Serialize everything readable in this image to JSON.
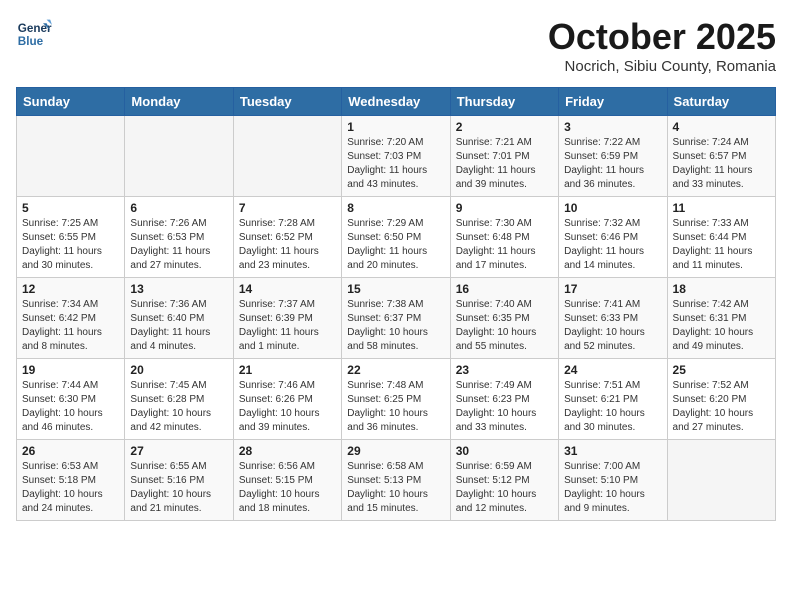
{
  "logo": {
    "line1": "General",
    "line2": "Blue"
  },
  "title": "October 2025",
  "subtitle": "Nocrich, Sibiu County, Romania",
  "days_of_week": [
    "Sunday",
    "Monday",
    "Tuesday",
    "Wednesday",
    "Thursday",
    "Friday",
    "Saturday"
  ],
  "weeks": [
    [
      {
        "day": "",
        "content": ""
      },
      {
        "day": "",
        "content": ""
      },
      {
        "day": "",
        "content": ""
      },
      {
        "day": "1",
        "content": "Sunrise: 7:20 AM\nSunset: 7:03 PM\nDaylight: 11 hours and 43 minutes."
      },
      {
        "day": "2",
        "content": "Sunrise: 7:21 AM\nSunset: 7:01 PM\nDaylight: 11 hours and 39 minutes."
      },
      {
        "day": "3",
        "content": "Sunrise: 7:22 AM\nSunset: 6:59 PM\nDaylight: 11 hours and 36 minutes."
      },
      {
        "day": "4",
        "content": "Sunrise: 7:24 AM\nSunset: 6:57 PM\nDaylight: 11 hours and 33 minutes."
      }
    ],
    [
      {
        "day": "5",
        "content": "Sunrise: 7:25 AM\nSunset: 6:55 PM\nDaylight: 11 hours and 30 minutes."
      },
      {
        "day": "6",
        "content": "Sunrise: 7:26 AM\nSunset: 6:53 PM\nDaylight: 11 hours and 27 minutes."
      },
      {
        "day": "7",
        "content": "Sunrise: 7:28 AM\nSunset: 6:52 PM\nDaylight: 11 hours and 23 minutes."
      },
      {
        "day": "8",
        "content": "Sunrise: 7:29 AM\nSunset: 6:50 PM\nDaylight: 11 hours and 20 minutes."
      },
      {
        "day": "9",
        "content": "Sunrise: 7:30 AM\nSunset: 6:48 PM\nDaylight: 11 hours and 17 minutes."
      },
      {
        "day": "10",
        "content": "Sunrise: 7:32 AM\nSunset: 6:46 PM\nDaylight: 11 hours and 14 minutes."
      },
      {
        "day": "11",
        "content": "Sunrise: 7:33 AM\nSunset: 6:44 PM\nDaylight: 11 hours and 11 minutes."
      }
    ],
    [
      {
        "day": "12",
        "content": "Sunrise: 7:34 AM\nSunset: 6:42 PM\nDaylight: 11 hours and 8 minutes."
      },
      {
        "day": "13",
        "content": "Sunrise: 7:36 AM\nSunset: 6:40 PM\nDaylight: 11 hours and 4 minutes."
      },
      {
        "day": "14",
        "content": "Sunrise: 7:37 AM\nSunset: 6:39 PM\nDaylight: 11 hours and 1 minute."
      },
      {
        "day": "15",
        "content": "Sunrise: 7:38 AM\nSunset: 6:37 PM\nDaylight: 10 hours and 58 minutes."
      },
      {
        "day": "16",
        "content": "Sunrise: 7:40 AM\nSunset: 6:35 PM\nDaylight: 10 hours and 55 minutes."
      },
      {
        "day": "17",
        "content": "Sunrise: 7:41 AM\nSunset: 6:33 PM\nDaylight: 10 hours and 52 minutes."
      },
      {
        "day": "18",
        "content": "Sunrise: 7:42 AM\nSunset: 6:31 PM\nDaylight: 10 hours and 49 minutes."
      }
    ],
    [
      {
        "day": "19",
        "content": "Sunrise: 7:44 AM\nSunset: 6:30 PM\nDaylight: 10 hours and 46 minutes."
      },
      {
        "day": "20",
        "content": "Sunrise: 7:45 AM\nSunset: 6:28 PM\nDaylight: 10 hours and 42 minutes."
      },
      {
        "day": "21",
        "content": "Sunrise: 7:46 AM\nSunset: 6:26 PM\nDaylight: 10 hours and 39 minutes."
      },
      {
        "day": "22",
        "content": "Sunrise: 7:48 AM\nSunset: 6:25 PM\nDaylight: 10 hours and 36 minutes."
      },
      {
        "day": "23",
        "content": "Sunrise: 7:49 AM\nSunset: 6:23 PM\nDaylight: 10 hours and 33 minutes."
      },
      {
        "day": "24",
        "content": "Sunrise: 7:51 AM\nSunset: 6:21 PM\nDaylight: 10 hours and 30 minutes."
      },
      {
        "day": "25",
        "content": "Sunrise: 7:52 AM\nSunset: 6:20 PM\nDaylight: 10 hours and 27 minutes."
      }
    ],
    [
      {
        "day": "26",
        "content": "Sunrise: 6:53 AM\nSunset: 5:18 PM\nDaylight: 10 hours and 24 minutes."
      },
      {
        "day": "27",
        "content": "Sunrise: 6:55 AM\nSunset: 5:16 PM\nDaylight: 10 hours and 21 minutes."
      },
      {
        "day": "28",
        "content": "Sunrise: 6:56 AM\nSunset: 5:15 PM\nDaylight: 10 hours and 18 minutes."
      },
      {
        "day": "29",
        "content": "Sunrise: 6:58 AM\nSunset: 5:13 PM\nDaylight: 10 hours and 15 minutes."
      },
      {
        "day": "30",
        "content": "Sunrise: 6:59 AM\nSunset: 5:12 PM\nDaylight: 10 hours and 12 minutes."
      },
      {
        "day": "31",
        "content": "Sunrise: 7:00 AM\nSunset: 5:10 PM\nDaylight: 10 hours and 9 minutes."
      },
      {
        "day": "",
        "content": ""
      }
    ]
  ]
}
